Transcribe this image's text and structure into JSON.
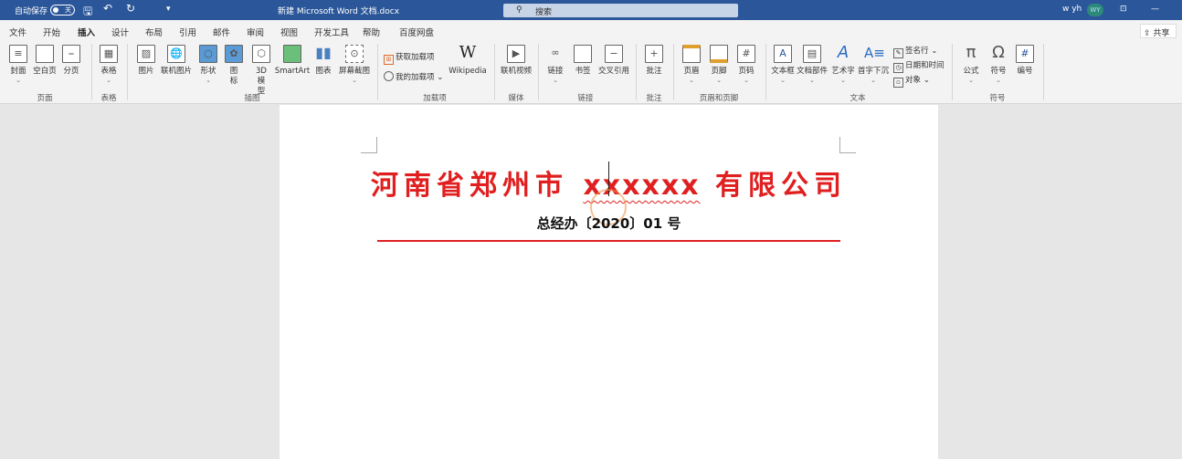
{
  "titlebar": {
    "autosave": "自动保存",
    "toggle": "关",
    "doc_title": "新建 Microsoft Word 文档.docx",
    "search": "搜索",
    "user": "w yh",
    "avatar": "WY",
    "accent": "#2b579a"
  },
  "tabs": [
    "文件",
    "开始",
    "插入",
    "设计",
    "布局",
    "引用",
    "邮件",
    "审阅",
    "视图",
    "开发工具",
    "帮助",
    "百度网盘"
  ],
  "share": "共享",
  "ribbon": {
    "buttons": [
      "封面",
      "空白页",
      "分页",
      "表格",
      "图片",
      "联机图片",
      "形状",
      "图标",
      "3D模型",
      "SmartArt",
      "图表",
      "屏幕截图",
      "Wikipedia",
      "联机视频",
      "链接",
      "书签",
      "交叉引用",
      "批注",
      "页眉",
      "页脚",
      "页码",
      "文本框",
      "文档部件",
      "艺术字",
      "首字下沉",
      "公式",
      "符号",
      "编号"
    ],
    "small": [
      "获取加载项",
      "我的加载项",
      "签名行",
      "日期和时间",
      "对象"
    ],
    "groups": [
      "页面",
      "表格",
      "插图",
      "加载项",
      "媒体",
      "链接",
      "批注",
      "页眉和页脚",
      "文本",
      "符号"
    ]
  },
  "document": {
    "title_pre": "河南省郑州市 ",
    "title_x": "xxxxxx",
    "title_post": " 有限公司",
    "subtitle": "总经办〔2020〕01 号",
    "red": "#e02020"
  }
}
